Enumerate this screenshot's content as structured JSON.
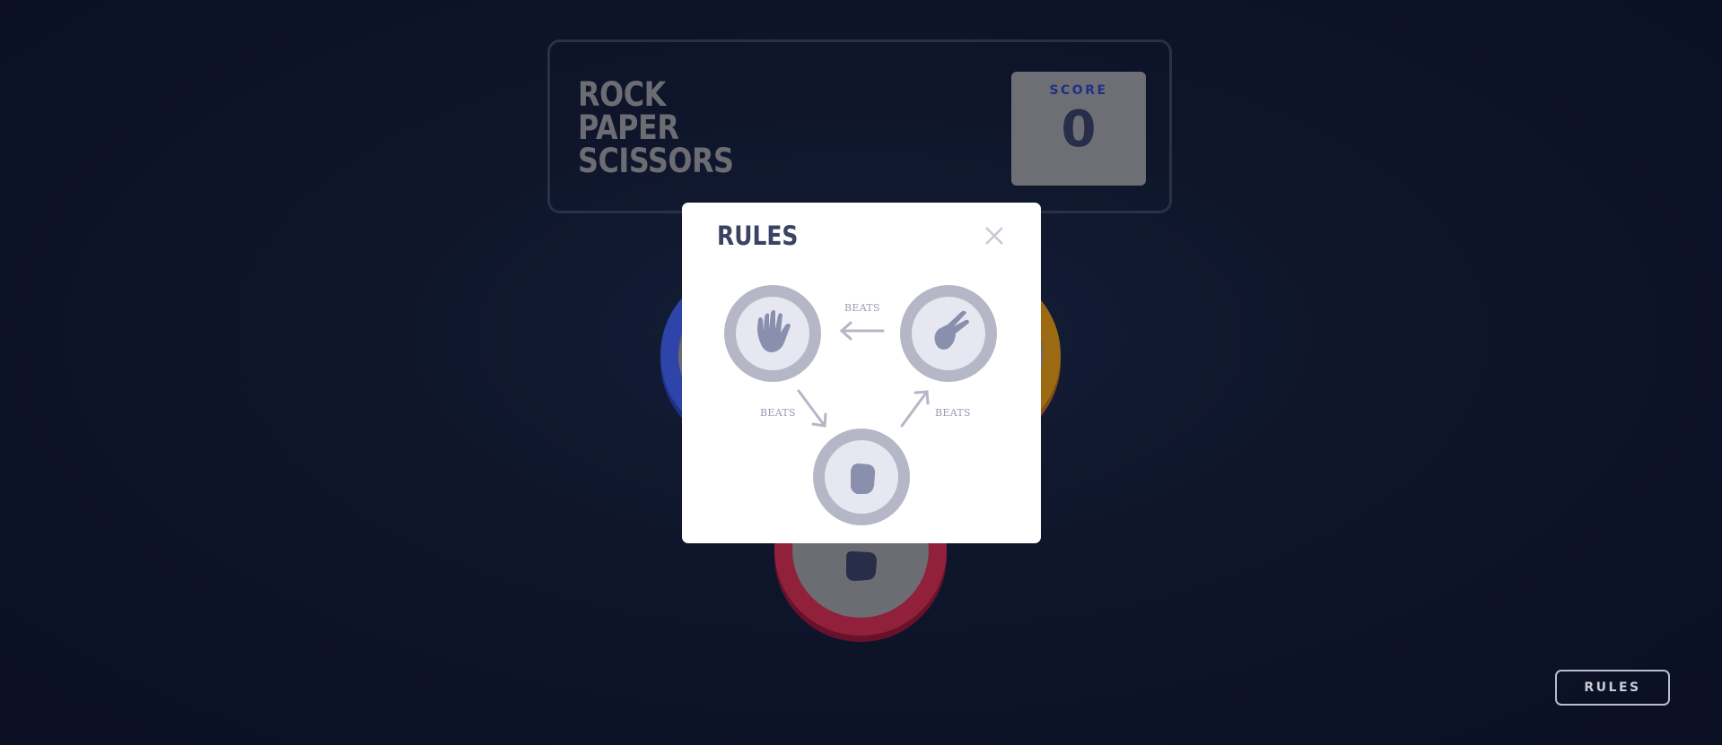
{
  "header": {
    "title_lines": [
      "ROCK",
      "PAPER",
      "SCISSORS"
    ],
    "score_label": "SCORE",
    "score_value": "0"
  },
  "game": {
    "choices": [
      {
        "name": "paper",
        "color": "#4664f4"
      },
      {
        "name": "scissors",
        "color": "#ec9e0e"
      },
      {
        "name": "rock",
        "color": "#dc2e4e"
      }
    ]
  },
  "modal": {
    "title": "RULES",
    "close_icon": "close-icon",
    "beats_labels": [
      "BEATS",
      "BEATS",
      "BEATS"
    ],
    "items": [
      {
        "name": "paper",
        "icon": "hand-paper-icon"
      },
      {
        "name": "scissors",
        "icon": "hand-scissors-icon"
      },
      {
        "name": "rock",
        "icon": "hand-rock-icon"
      }
    ]
  },
  "footer": {
    "rules_button_label": "RULES"
  },
  "colors": {
    "background": "#131c33",
    "header_border": "#3b4760",
    "title_text": "#a3a3a3",
    "score_label": "#2a46c0",
    "score_value": "#3b4363",
    "rules_ring": "#b6b7c6",
    "rules_hand": "#8a8fad"
  }
}
